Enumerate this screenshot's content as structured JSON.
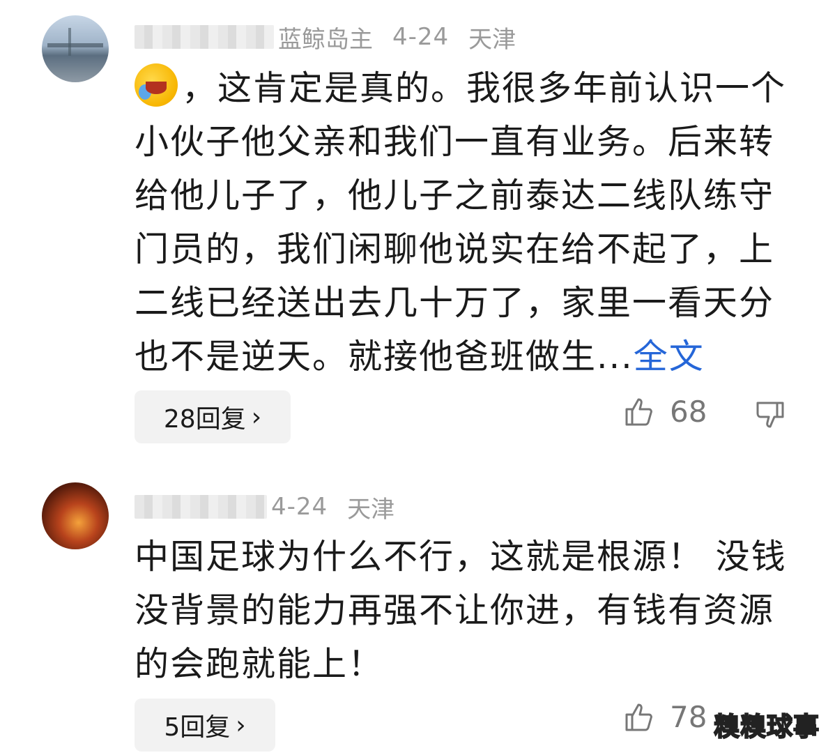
{
  "comments": [
    {
      "username_visible": "蓝鲸岛主",
      "date": "4-24",
      "location": "天津",
      "text_after_emoji": "，这肯定是真的。我很多年前认识一个小伙子他父亲和我们一直有业务。后来转给他儿子了，他儿子之前泰达二线队练守门员的，我们闲聊他说实在给不起了，上二线已经送出去几十万了，家里一看天分也不是逆天。就接他爸班做生...",
      "expand_label": "全文",
      "reply_label": "28回复",
      "like_count": "68"
    },
    {
      "username_visible": "",
      "date": "4-24",
      "location": "天津",
      "text": "中国足球为什么不行，这就是根源！ 没钱没背景的能力再强不让你进，有钱有资源的会跑就能上！",
      "reply_label": "5回复",
      "like_count": "78"
    }
  ],
  "icons": {
    "emoji": "laughing-crying-face-icon",
    "like": "thumbs-up-icon",
    "dislike": "thumbs-down-icon",
    "chevron": "chevron-right-icon"
  },
  "watermark": "糗糗球事",
  "colors": {
    "meta_text": "#9a9a9a",
    "body_text": "#1a1a1a",
    "link": "#2566d8",
    "reply_bg": "#f2f2f2",
    "icon": "#777777"
  }
}
